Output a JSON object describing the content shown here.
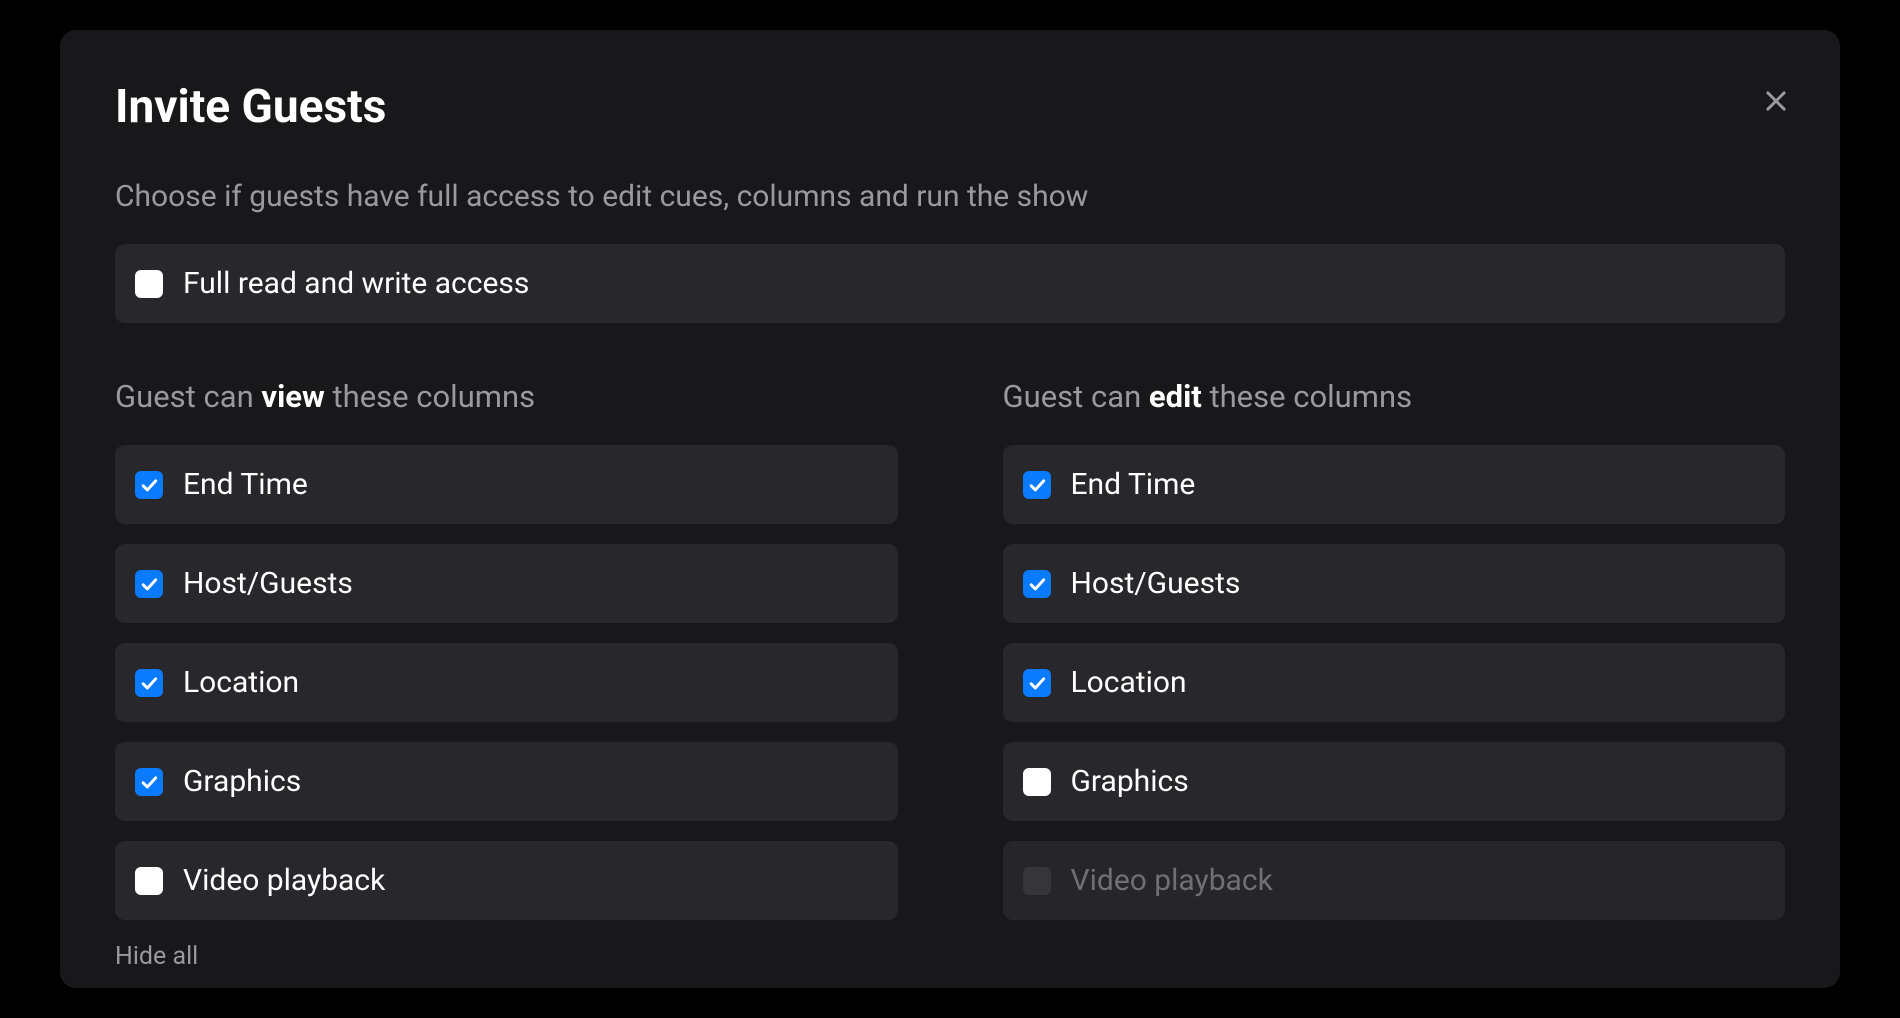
{
  "modal": {
    "title": "Invite Guests",
    "description": "Choose if guests have full access to edit cues, columns and run the show",
    "close_icon": "close"
  },
  "full_access": {
    "label": "Full read and write access",
    "checked": false
  },
  "view_column": {
    "header_prefix": "Guest can ",
    "header_bold": "view",
    "header_suffix": " these columns",
    "options": [
      {
        "label": "End Time",
        "checked": true,
        "disabled": false
      },
      {
        "label": "Host/Guests",
        "checked": true,
        "disabled": false
      },
      {
        "label": "Location",
        "checked": true,
        "disabled": false
      },
      {
        "label": "Graphics",
        "checked": true,
        "disabled": false
      },
      {
        "label": "Video playback",
        "checked": false,
        "disabled": false
      }
    ],
    "hide_all_label": "Hide all"
  },
  "edit_column": {
    "header_prefix": "Guest can ",
    "header_bold": "edit",
    "header_suffix": " these columns",
    "options": [
      {
        "label": "End Time",
        "checked": true,
        "disabled": false
      },
      {
        "label": "Host/Guests",
        "checked": true,
        "disabled": false
      },
      {
        "label": "Location",
        "checked": true,
        "disabled": false
      },
      {
        "label": "Graphics",
        "checked": false,
        "disabled": false
      },
      {
        "label": "Video playback",
        "checked": false,
        "disabled": true
      }
    ]
  }
}
